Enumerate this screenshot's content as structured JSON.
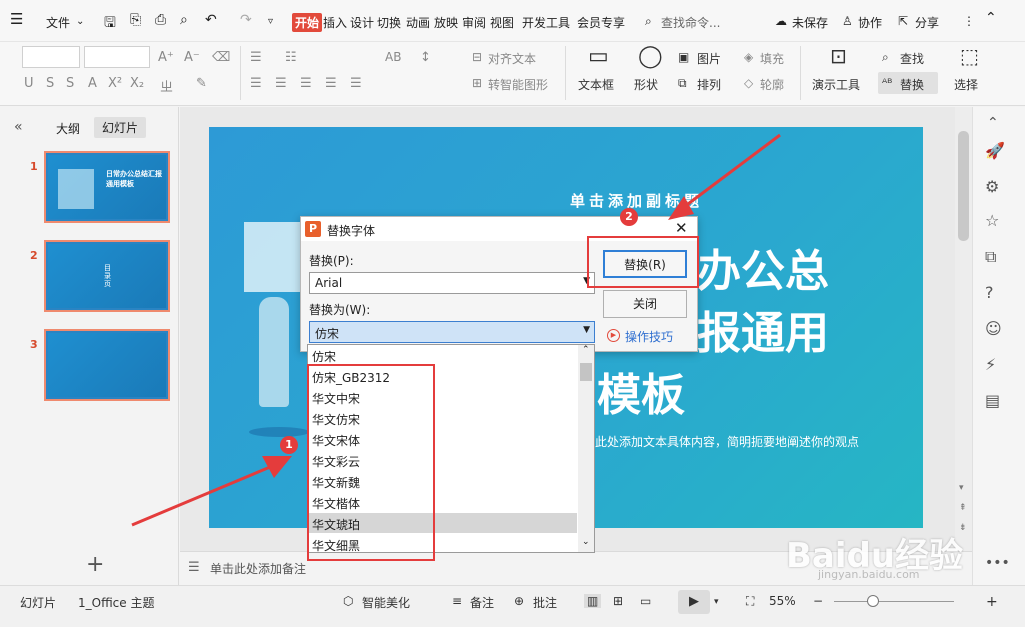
{
  "menubar": {
    "file": "文件",
    "tabs": [
      "开始",
      "插入",
      "设计",
      "切换",
      "动画",
      "放映",
      "审阅",
      "视图",
      "开发工具",
      "会员专享"
    ],
    "search": "查找命令...",
    "unsaved": "未保存",
    "collab": "协作",
    "share": "分享"
  },
  "ribbon": {
    "align_text": "对齐文本",
    "smart_shape": "转智能图形",
    "textbox": "文本框",
    "shape": "形状",
    "picture": "图片",
    "arrange": "排列",
    "fill": "填充",
    "outline": "轮廓",
    "present_tools": "演示工具",
    "find": "查找",
    "replace": "替换",
    "select": "选择"
  },
  "left_panel": {
    "tab_outline": "大纲",
    "tab_slides": "幻灯片",
    "slide_numbers": [
      "1",
      "2",
      "3"
    ],
    "thumb1_text": "日常办公总结汇报通用模板",
    "thumb2_text": "目录页",
    "add_label": "+"
  },
  "slide": {
    "subtitle": "单击添加副标题",
    "title_line1": "办公总",
    "title_line2": "报通用",
    "title_line3": "模板",
    "body": "此处添加文本具体内容，简明扼要地阐述你的观点"
  },
  "dialog": {
    "title": "替换字体",
    "replace_label": "替换(P):",
    "replace_value": "Arial",
    "with_label": "替换为(W):",
    "with_value": "仿宋",
    "replace_button": "替换(R)",
    "close_button": "关闭",
    "tips_link": "操作技巧"
  },
  "font_list": [
    "仿宋",
    "仿宋_GB2312",
    "华文中宋",
    "华文仿宋",
    "华文宋体",
    "华文彩云",
    "华文新魏",
    "华文楷体",
    "华文琥珀",
    "华文细黑"
  ],
  "annotations": {
    "badge1": "1",
    "badge2": "2"
  },
  "notes": {
    "placeholder": "单击此处添加备注"
  },
  "statusbar": {
    "slides": "幻灯片",
    "theme": "1_Office 主题",
    "beautify": "智能美化",
    "notes": "备注",
    "comments": "批注",
    "zoom": "55%"
  },
  "watermark": {
    "text": "Baidu经验",
    "url": "jingyan.baidu.com"
  },
  "colors": {
    "accent": "#e24a3b",
    "annotation": "#e43c3c",
    "slide_bg": "#2a9ed2",
    "highlight": "#1f6fc4"
  }
}
